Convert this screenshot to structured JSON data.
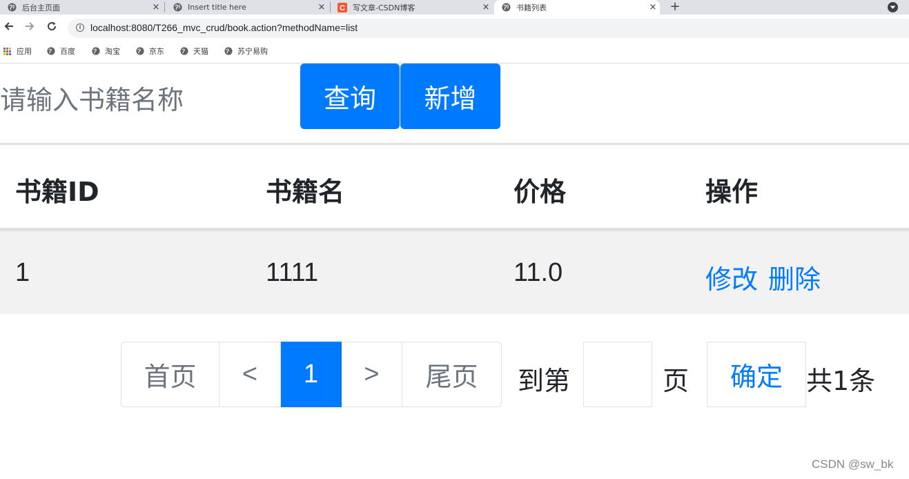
{
  "browser": {
    "tabs": [
      {
        "title": "后台主页面",
        "icon": "globe-icon"
      },
      {
        "title": "Insert title here",
        "icon": "globe-icon"
      },
      {
        "title": "写文章-CSDN博客",
        "icon": "csdn-icon",
        "icon_color": "#fc5531"
      },
      {
        "title": "书籍列表",
        "icon": "globe-icon",
        "active": true
      }
    ],
    "tab_close": "×",
    "new_tab": "+",
    "url": "localhost:8080/T266_mvc_crud/book.action?methodName=list",
    "bookmarks": [
      {
        "label": "应用",
        "icon": "apps-grid-icon"
      },
      {
        "label": "百度",
        "icon": "globe-icon"
      },
      {
        "label": "淘宝",
        "icon": "globe-icon"
      },
      {
        "label": "京东",
        "icon": "globe-icon"
      },
      {
        "label": "天猫",
        "icon": "globe-icon"
      },
      {
        "label": "苏宁易购",
        "icon": "globe-icon"
      }
    ]
  },
  "search": {
    "placeholder": "请输入书籍名称",
    "query_button": "查询",
    "add_button": "新增"
  },
  "table": {
    "headers": [
      "书籍ID",
      "书籍名",
      "价格",
      "操作"
    ],
    "rows": [
      {
        "id": "1",
        "name": "1111",
        "price": "11.0",
        "edit": "修改",
        "delete": "删除"
      }
    ]
  },
  "pagination": {
    "first": "首页",
    "prev": "<",
    "current": "1",
    "next": ">",
    "last": "尾页",
    "goto_prefix": "到第",
    "goto_suffix": "页",
    "confirm": "确定",
    "total": "共1条"
  },
  "watermark": "CSDN @sw_bk",
  "colors": {
    "primary": "#007bff",
    "row_stripe": "#f2f2f2",
    "border": "#dee2e6"
  }
}
